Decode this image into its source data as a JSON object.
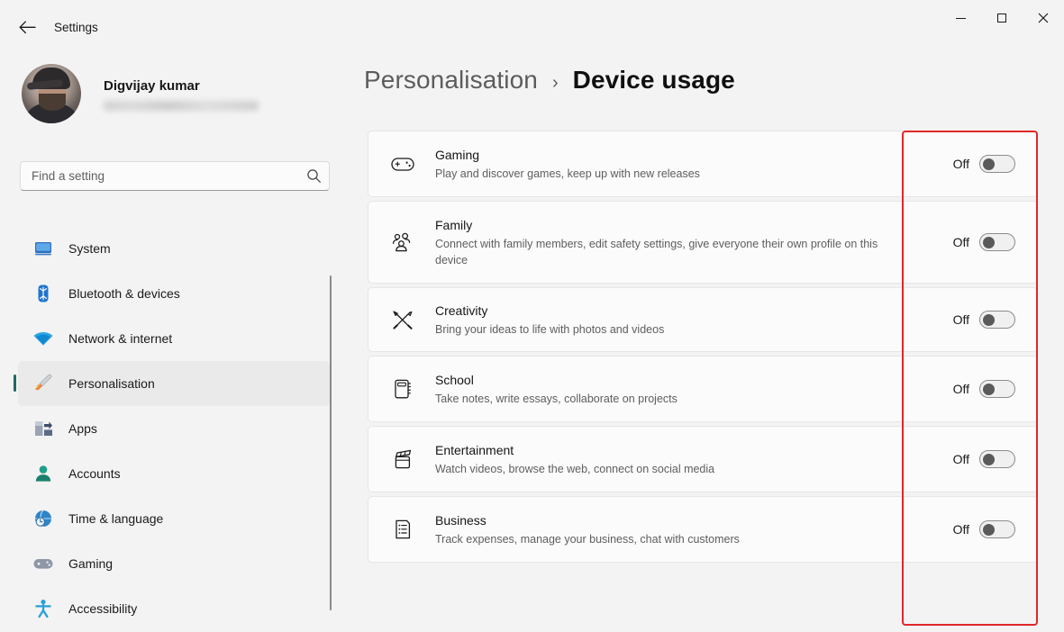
{
  "window": {
    "app_title": "Settings",
    "back_icon": "back-arrow-icon",
    "controls": {
      "minimize": "minimize",
      "maximize": "maximize",
      "close": "close"
    }
  },
  "sidebar": {
    "profile": {
      "name": "Digvijay kumar",
      "email_hidden": ""
    },
    "search": {
      "placeholder": "Find a setting",
      "value": "",
      "icon": "search-icon"
    },
    "items": [
      {
        "label": "System",
        "icon": "monitor-icon",
        "active": false
      },
      {
        "label": "Bluetooth & devices",
        "icon": "bluetooth-icon",
        "active": false
      },
      {
        "label": "Network & internet",
        "icon": "wifi-icon",
        "active": false
      },
      {
        "label": "Personalisation",
        "icon": "paintbrush-icon",
        "active": true
      },
      {
        "label": "Apps",
        "icon": "apps-icon",
        "active": false
      },
      {
        "label": "Accounts",
        "icon": "account-icon",
        "active": false
      },
      {
        "label": "Time & language",
        "icon": "clock-globe-icon",
        "active": false
      },
      {
        "label": "Gaming",
        "icon": "gamepad-icon",
        "active": false
      },
      {
        "label": "Accessibility",
        "icon": "accessibility-icon",
        "active": false
      }
    ]
  },
  "main": {
    "breadcrumb": {
      "parent": "Personalisation",
      "separator": "›",
      "current": "Device usage"
    },
    "cards": [
      {
        "title": "Gaming",
        "subtitle": "Play and discover games, keep up with new releases",
        "icon": "gamepad-icon",
        "toggle_label": "Off",
        "toggle_state": "off"
      },
      {
        "title": "Family",
        "subtitle": "Connect with family members, edit safety settings, give everyone their own profile on this device",
        "icon": "family-group-icon",
        "toggle_label": "Off",
        "toggle_state": "off"
      },
      {
        "title": "Creativity",
        "subtitle": "Bring your ideas to life with photos and videos",
        "icon": "pencil-brush-icon",
        "toggle_label": "Off",
        "toggle_state": "off"
      },
      {
        "title": "School",
        "subtitle": "Take notes, write essays, collaborate on projects",
        "icon": "notebook-icon",
        "toggle_label": "Off",
        "toggle_state": "off"
      },
      {
        "title": "Entertainment",
        "subtitle": "Watch videos, browse the web, connect on social media",
        "icon": "clapperboard-icon",
        "toggle_label": "Off",
        "toggle_state": "off"
      },
      {
        "title": "Business",
        "subtitle": "Track expenses, manage your business, chat with customers",
        "icon": "document-list-icon",
        "toggle_label": "Off",
        "toggle_state": "off"
      }
    ],
    "annotation": {
      "type": "rectangle-highlight",
      "color": "#e0272b",
      "target": "toggle-column"
    }
  },
  "colors": {
    "page_bg": "#f3f3f3",
    "card_bg": "#fbfbfb",
    "card_border": "#e6e6e6",
    "accent_bar": "#1d6b63",
    "highlight": "#e0272b",
    "text_primary": "#151515",
    "text_secondary": "#5e5e5e"
  }
}
